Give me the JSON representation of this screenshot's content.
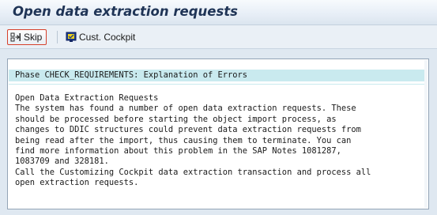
{
  "window": {
    "title": "Open data extraction requests"
  },
  "toolbar": {
    "skip_label": "Skip",
    "skip_icon": "skip-icon",
    "cockpit_label": "Cust. Cockpit",
    "cockpit_icon": "cockpit-icon"
  },
  "message": {
    "header": "Phase CHECK_REQUIREMENTS: Explanation of Errors",
    "lines": [
      "Open Data Extraction Requests",
      "The system has found a number of open data extraction requests. These",
      "should be processed before starting the object import process, as",
      "changes to DDIC structures could prevent data extraction requests from",
      "being read after the import, thus causing them to terminate. You can",
      "find more information about this problem in the SAP Notes 1081287,",
      "1083709 and 328181.",
      "Call the Customizing Cockpit data extraction transaction and process all",
      "open extraction requests."
    ]
  },
  "colors": {
    "title_text": "#1f3456",
    "header_highlight": "#c9eaef",
    "skip_border": "#d6402b",
    "background": "#dfe8f1"
  }
}
